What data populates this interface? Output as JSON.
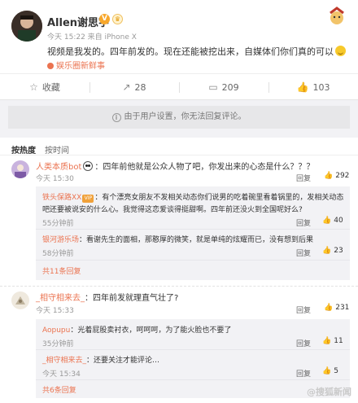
{
  "post": {
    "username": "Allen谢思宇",
    "v_badge": "V",
    "c_badge": "♛",
    "meta": "今天 15:22 来自 iPhone X",
    "text": "视频是我发的。四年前发的。现在还能被挖出来，自媒体们你们真的可以",
    "topic": "娱乐圈新鲜事"
  },
  "actions": [
    {
      "icon": "☆",
      "icon_name": "star-icon",
      "label": "收藏"
    },
    {
      "icon": "↗",
      "icon_name": "share-icon",
      "label": "28"
    },
    {
      "icon": "▭",
      "icon_name": "comment-icon",
      "label": "209"
    },
    {
      "icon": "👍",
      "icon_name": "thumb-icon",
      "label": "103"
    }
  ],
  "notice": {
    "icon": "i",
    "text": "由于用户设置，你无法回复评论。"
  },
  "sort": {
    "active": "按热度",
    "idle": "按时间"
  },
  "comments": [
    {
      "name": "人类本质bot",
      "text": "：四年前他就是公众人物了吧，你发出来的心态是什么？？？",
      "time": "今天 15:30",
      "reply_label": "回复",
      "likes": "292",
      "avatar_color": "#b28bd0",
      "replies": [
        {
          "name": "铁头保路XX",
          "line1": "：有个漂亮女朋友不发相关动态你们说男的吃着碗里看着锅里的，发相关动态",
          "line2": "吧还要被说安的什么心。我觉得这恋爱谈得挺甜啊。四年前还没火到全国呢好么?",
          "time": "55分钟前",
          "likes": "40"
        },
        {
          "name": "银河游乐场",
          "line1": "：看谢先生的面相，那憨厚的微笑，就是单纯的炫耀而已，没有想到后果",
          "line2": "",
          "time": "58分钟前",
          "likes": "23"
        }
      ],
      "more": "共11条回复"
    },
    {
      "name": "_相守相来去_",
      "text": "：四年前发就理直气壮了?",
      "time": "今天 15:33",
      "reply_label": "回复",
      "likes": "231",
      "avatar_color": "#e9e2d6",
      "replies": [
        {
          "name": "Aopupu",
          "line1": "：光着屁股卖衬衣，呵呵呵，为了能火脸也不要了",
          "line2": "",
          "time": "35分钟前",
          "likes": "11"
        },
        {
          "name": "_相守相来去_",
          "line1": "：还要关注才能评论…",
          "line2": "",
          "time": "今天 15:34",
          "likes": "5"
        }
      ],
      "more": "共6条回复"
    }
  ],
  "watermark": "@搜狐新闻"
}
